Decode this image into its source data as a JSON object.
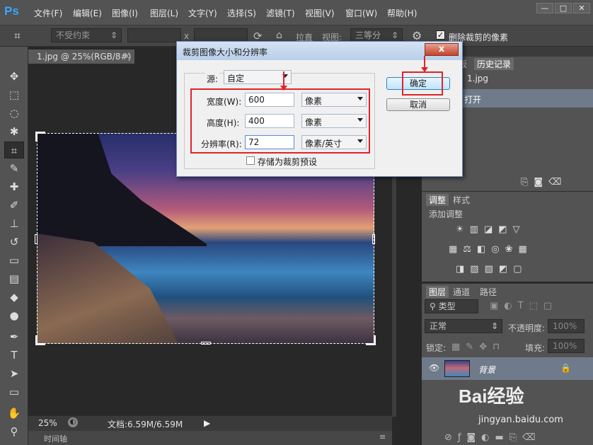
{
  "app": {
    "logo": "Ps"
  },
  "menubar": {
    "items": [
      "文件(F)",
      "编辑(E)",
      "图像(I)",
      "图层(L)",
      "文字(Y)",
      "选择(S)",
      "滤镜(T)",
      "视图(V)",
      "窗口(W)",
      "帮助(H)"
    ],
    "win_controls": [
      "—",
      "□",
      "✕"
    ]
  },
  "options": {
    "preset": "不受约束",
    "x_sep": "x",
    "straighten": "拉直",
    "view_label": "视图:",
    "view_value": "三等分",
    "delete_cropped": "删除裁剪的像素"
  },
  "document": {
    "tab_title": "1.jpg @ 25%(RGB/8#)",
    "tab_close": "×",
    "zoom": "25%",
    "doc_info": "文档:6.59M/6.59M",
    "timeline": "时间轴"
  },
  "dialog": {
    "title": "裁剪图像大小和分辨率",
    "close": "x",
    "source_label": "源:",
    "source_value": "自定",
    "width_label": "宽度(W):",
    "width_value": "600",
    "width_unit": "像素",
    "height_label": "高度(H):",
    "height_value": "400",
    "height_unit": "像素",
    "res_label": "分辨率(R):",
    "res_value": "72",
    "res_unit": "像素/英寸",
    "save_preset": "存储为裁剪预设",
    "ok": "确定",
    "cancel": "取消"
  },
  "panels": {
    "history_tab1": "板",
    "history_tab2": "历史记录",
    "history_file": "1.jpg",
    "history_open": "打开",
    "adjust_tab1": "调整",
    "adjust_tab2": "样式",
    "adjust_title": "添加调整",
    "layers_tab1": "图层",
    "layers_tab2": "通道",
    "layers_tab3": "路径",
    "kind": "类型",
    "blend": "正常",
    "opacity_label": "不透明度:",
    "opacity_value": "100%",
    "lock_label": "锁定:",
    "fill_label": "填充:",
    "fill_value": "100%",
    "layer_name": "背景"
  },
  "watermark": {
    "brand": "Bai经验",
    "url": "jingyan.baidu.com"
  }
}
